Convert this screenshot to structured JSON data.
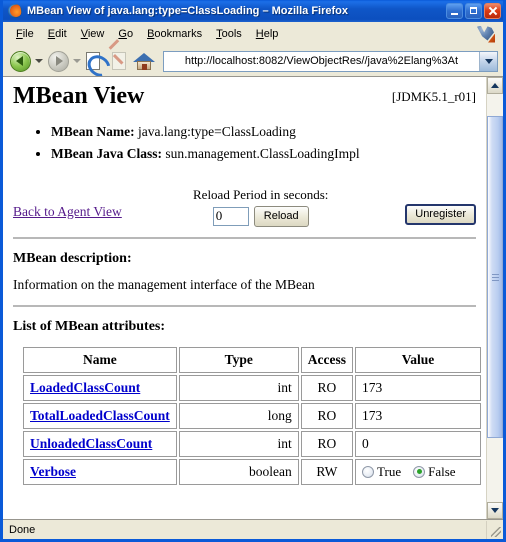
{
  "window": {
    "title": "MBean View of java.lang:type=ClassLoading – Mozilla Firefox",
    "minimize_label": "Minimize",
    "maximize_label": "Maximize",
    "close_label": "Close"
  },
  "menubar": {
    "items": [
      {
        "label": "File",
        "accesskey": "F"
      },
      {
        "label": "Edit",
        "accesskey": "E"
      },
      {
        "label": "View",
        "accesskey": "V"
      },
      {
        "label": "Go",
        "accesskey": "G"
      },
      {
        "label": "Bookmarks",
        "accesskey": "B"
      },
      {
        "label": "Tools",
        "accesskey": "T"
      },
      {
        "label": "Help",
        "accesskey": "H"
      }
    ]
  },
  "toolbar": {
    "back_label": "Back",
    "forward_label": "Forward",
    "reload_label": "Reload",
    "stop_label": "Stop",
    "home_label": "Home",
    "url": "http://localhost:8082/ViewObjectRes//java%2Elang%3At"
  },
  "page": {
    "heading": "MBean View",
    "version": "[JDMK5.1_r01]",
    "facts": [
      {
        "label": "MBean Name:",
        "value": "java.lang:type=ClassLoading"
      },
      {
        "label": "MBean Java Class:",
        "value": "sun.management.ClassLoadingImpl"
      }
    ],
    "back_link": "Back to Agent View",
    "reload_period_label": "Reload Period in seconds:",
    "reload_period_value": "0",
    "reload_button": "Reload",
    "unregister_button": "Unregister",
    "description_heading": "MBean description:",
    "description_text": "Information on the management interface of the MBean",
    "attributes_heading": "List of MBean attributes:",
    "table": {
      "headers": [
        "Name",
        "Type",
        "Access",
        "Value"
      ],
      "rows": [
        {
          "name": "LoadedClassCount",
          "type": "int",
          "access": "RO",
          "value": "173",
          "kind": "text"
        },
        {
          "name": "TotalLoadedClassCount",
          "type": "long",
          "access": "RO",
          "value": "173",
          "kind": "text"
        },
        {
          "name": "UnloadedClassCount",
          "type": "int",
          "access": "RO",
          "value": "0",
          "kind": "text"
        },
        {
          "name": "Verbose",
          "type": "boolean",
          "access": "RW",
          "value": "False",
          "kind": "radio",
          "options": [
            "True",
            "False"
          ],
          "selected": "False"
        }
      ]
    }
  },
  "statusbar": {
    "text": "Done"
  },
  "colors": {
    "titlebar_blue": "#0f56c8",
    "window_border": "#0a5ad8",
    "chrome_beige": "#ece9d8",
    "link_blue": "#0000cc",
    "link_visited": "#551a8b",
    "radio_selected_green": "#2aa22a"
  }
}
